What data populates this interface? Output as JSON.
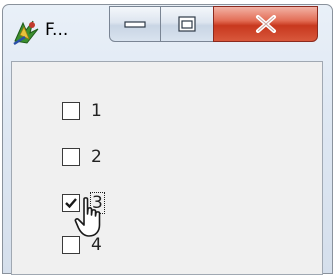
{
  "window": {
    "title": "F..."
  },
  "titlebar": {
    "icons": {
      "app": "app-icon",
      "minimize": "minimize-icon",
      "maximize": "maximize-icon",
      "close": "close-icon"
    }
  },
  "checkboxes": [
    {
      "label": "1",
      "checked": false,
      "focused": false
    },
    {
      "label": "2",
      "checked": false,
      "focused": false
    },
    {
      "label": "3",
      "checked": true,
      "focused": true
    },
    {
      "label": "4",
      "checked": false,
      "focused": false
    }
  ],
  "colors": {
    "close_button": "#d8583c",
    "window_frame": "#dfe8f3",
    "client_background": "#f0f0f0"
  }
}
